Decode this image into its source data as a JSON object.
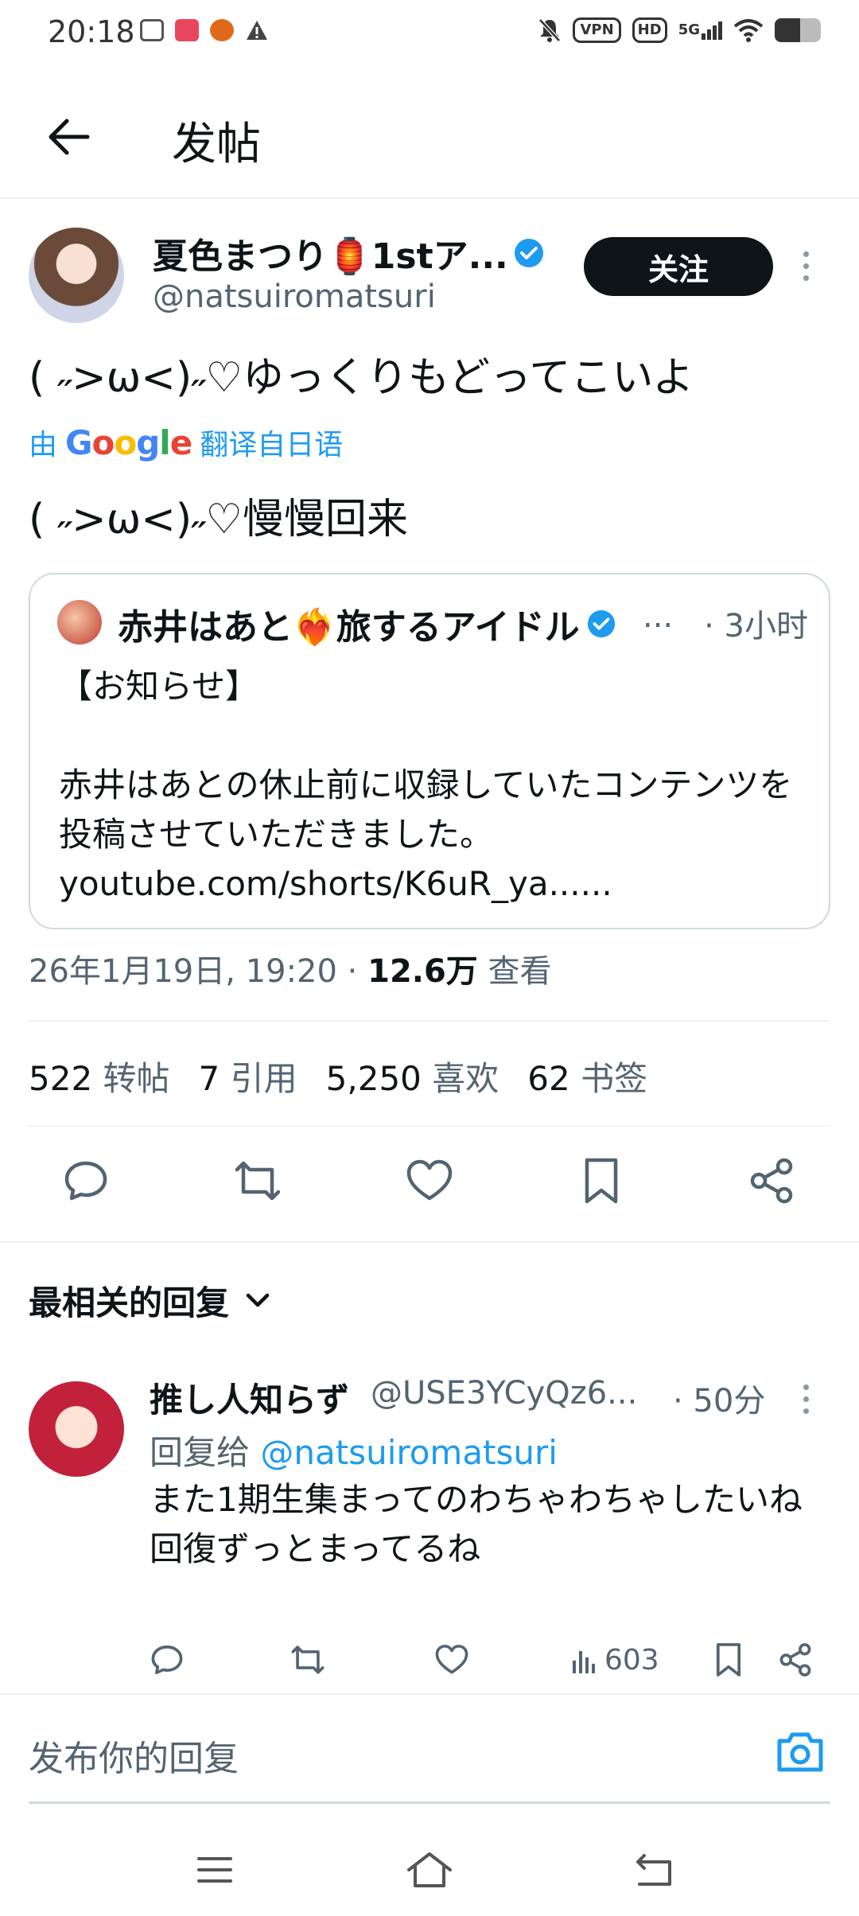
{
  "status_bar": {
    "time": "20:18",
    "vpn_label": "VPN",
    "hd_label": "HD",
    "network_label": "5G",
    "battery_level": 0.55
  },
  "header": {
    "title": "发帖"
  },
  "tweet": {
    "author_name": "夏色まつり🏮1stア...",
    "author_handle": "@natsuiromatsuri",
    "follow_label": "关注",
    "text": "( ˶>ω<)˶♡ゆっくりもどってこいよ",
    "translated_prefix": "由",
    "translated_brand": "Google",
    "translated_suffix": "翻译自日语",
    "translated_text": "( ˶>ω<)˶♡慢慢回来",
    "quote": {
      "author_name": "赤井はあと❤️‍🔥旅するアイドル",
      "ellipsis": "...",
      "time": "· 3小时",
      "body": "【お知らせ】\n\n赤井はあとの休止前に収録していたコンテンツを投稿させていただきました。\nyoutube.com/shorts/K6uR_ya......"
    },
    "date": "26年1月19日, 19:20 ·",
    "views_count": "12.6万",
    "views_label": "查看",
    "stats": [
      {
        "num": "522",
        "label": "转帖"
      },
      {
        "num": "7",
        "label": "引用"
      },
      {
        "num": "5,250",
        "label": "喜欢"
      },
      {
        "num": "62",
        "label": "书签"
      }
    ]
  },
  "replies": {
    "sort_label": "最相关的回复",
    "items": [
      {
        "name": "推し人知らず",
        "handle": "@USE3YCyQz6...",
        "time": "· 50分",
        "reply_to_prefix": "回复给",
        "reply_to_mention": "@natsuiromatsuri",
        "body": "また1期生集まってのわちゃわちゃしたいね\n回復ずっとまってるね",
        "views": "603"
      }
    ]
  },
  "compose": {
    "placeholder": "发布你的回复"
  },
  "colors": {
    "accent": "#1d9bf0",
    "text_primary": "#0f1419",
    "text_secondary": "#536471",
    "border": "#cfd9de"
  }
}
